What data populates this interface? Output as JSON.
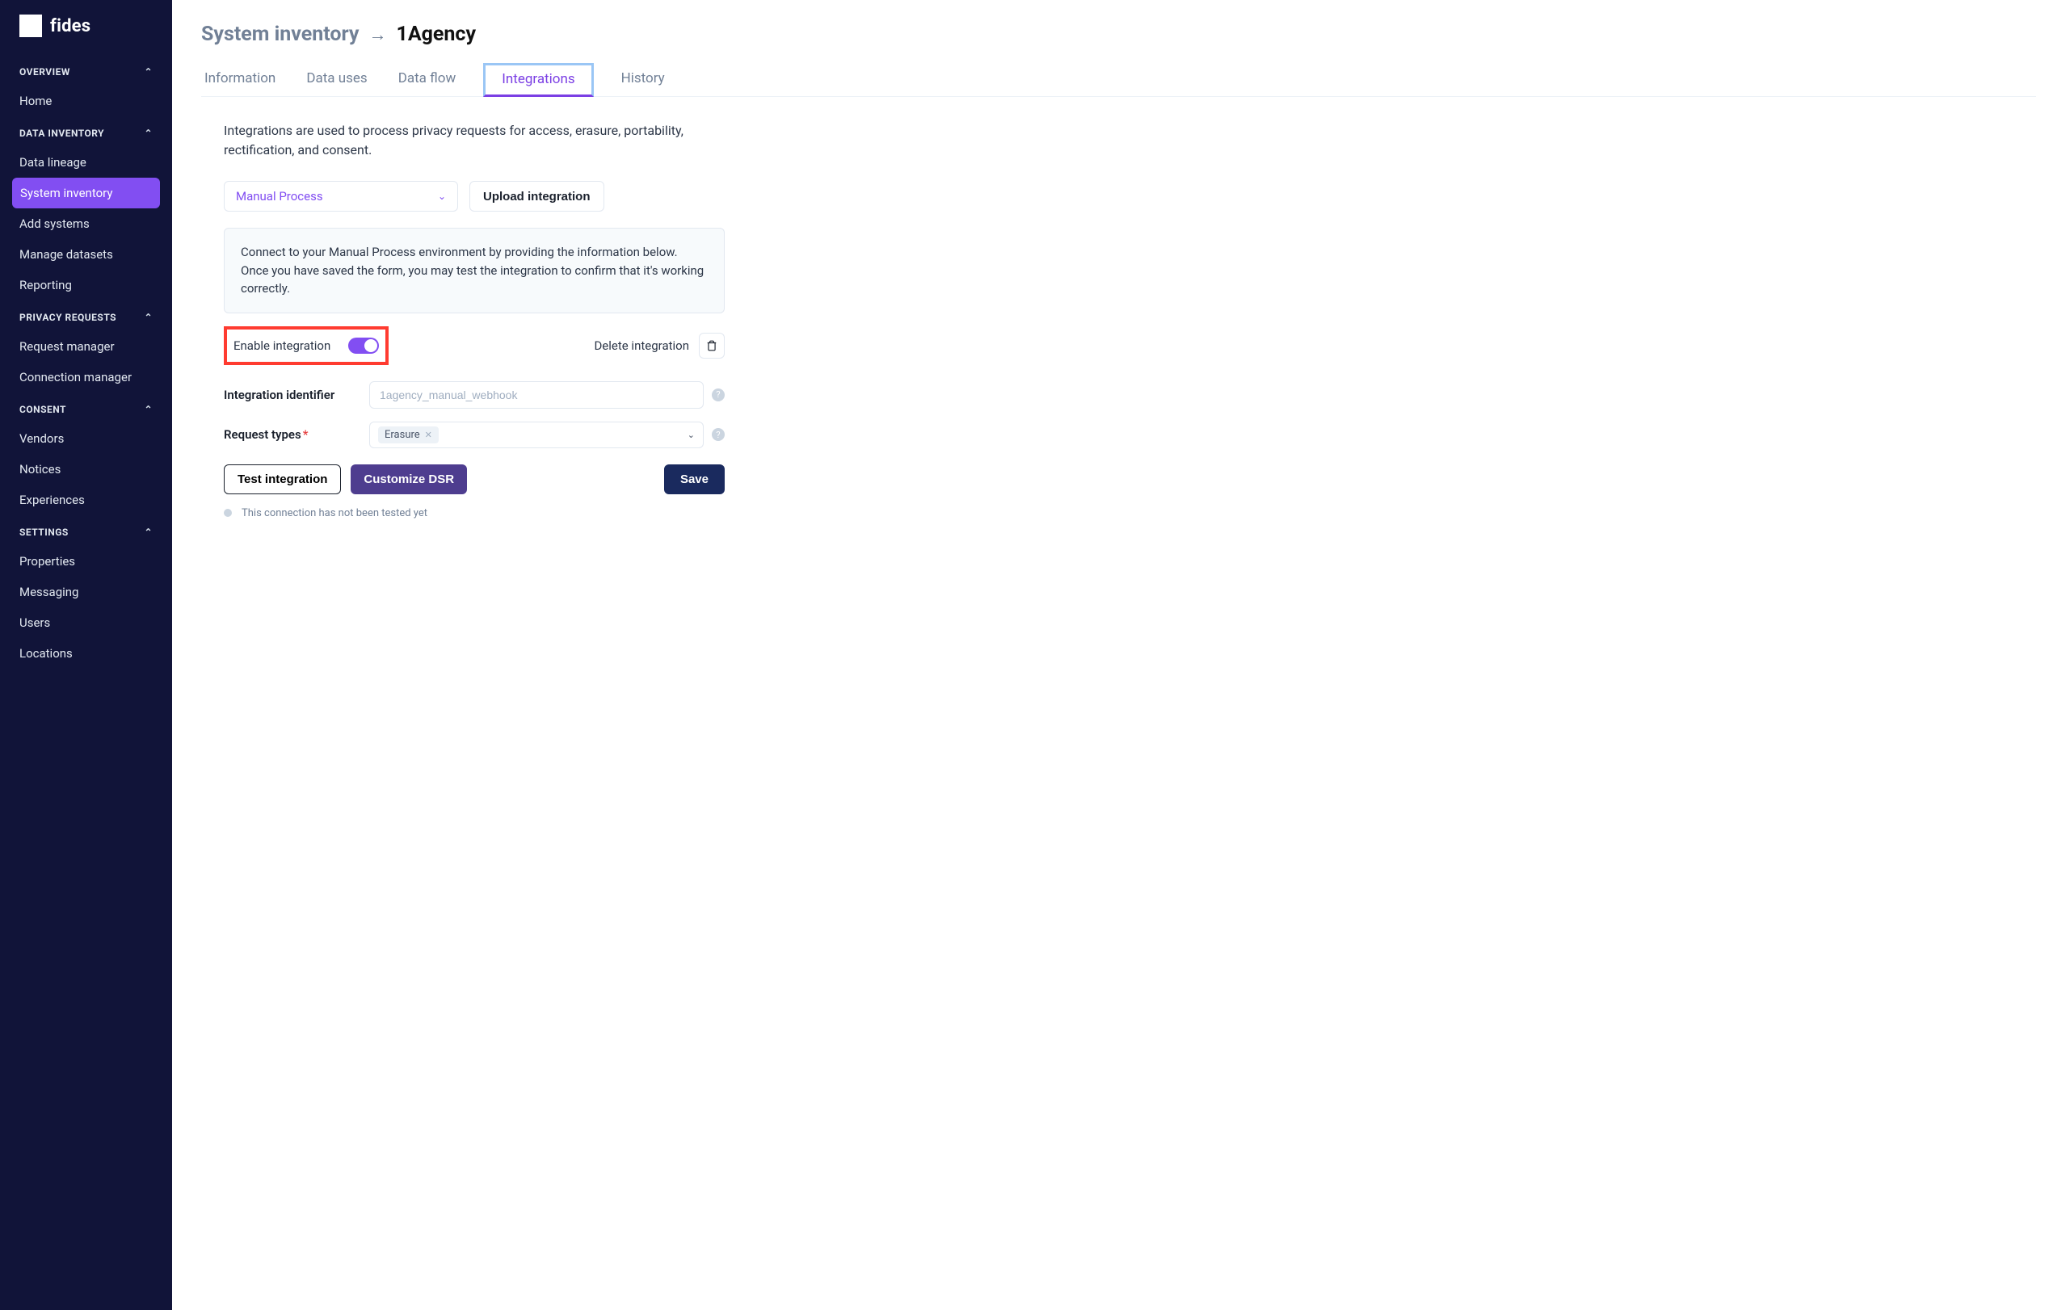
{
  "brand": "fides",
  "sidebar": {
    "sections": [
      {
        "label": "OVERVIEW",
        "items": [
          {
            "label": "Home",
            "active": false
          }
        ]
      },
      {
        "label": "DATA INVENTORY",
        "items": [
          {
            "label": "Data lineage",
            "active": false
          },
          {
            "label": "System inventory",
            "active": true
          },
          {
            "label": "Add systems",
            "active": false
          },
          {
            "label": "Manage datasets",
            "active": false
          },
          {
            "label": "Reporting",
            "active": false
          }
        ]
      },
      {
        "label": "PRIVACY REQUESTS",
        "items": [
          {
            "label": "Request manager",
            "active": false
          },
          {
            "label": "Connection manager",
            "active": false
          }
        ]
      },
      {
        "label": "CONSENT",
        "items": [
          {
            "label": "Vendors",
            "active": false
          },
          {
            "label": "Notices",
            "active": false
          },
          {
            "label": "Experiences",
            "active": false
          }
        ]
      },
      {
        "label": "SETTINGS",
        "items": [
          {
            "label": "Properties",
            "active": false
          },
          {
            "label": "Messaging",
            "active": false
          },
          {
            "label": "Users",
            "active": false
          },
          {
            "label": "Locations",
            "active": false
          }
        ]
      }
    ]
  },
  "breadcrumb": {
    "prev": "System inventory",
    "current": "1Agency"
  },
  "tabs": [
    {
      "label": "Information",
      "active": false
    },
    {
      "label": "Data uses",
      "active": false
    },
    {
      "label": "Data flow",
      "active": false
    },
    {
      "label": "Integrations",
      "active": true
    },
    {
      "label": "History",
      "active": false
    }
  ],
  "intro": "Integrations are used to process privacy requests for access, erasure, portability, rectification, and consent.",
  "select_integration": "Manual Process",
  "btn_upload": "Upload integration",
  "info_box": "Connect to your Manual Process environment by providing the information below. Once you have saved the form, you may test the integration to confirm that it's working correctly.",
  "enable_label": "Enable integration",
  "delete_label": "Delete integration",
  "field_identifier": {
    "label": "Integration identifier",
    "placeholder": "1agency_manual_webhook"
  },
  "field_request_types": {
    "label": "Request types",
    "tags": [
      "Erasure"
    ]
  },
  "btn_test": "Test integration",
  "btn_customize": "Customize DSR",
  "btn_save": "Save",
  "status_text": "This connection has not been tested yet"
}
